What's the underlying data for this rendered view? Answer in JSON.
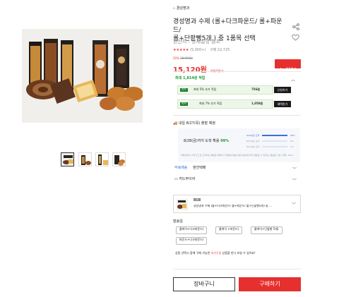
{
  "breadcrumb": {
    "store": "경성명과"
  },
  "product": {
    "title_line1": "경성명과 수제 (롤+다크파운드/ 롤+파운드/",
    "title_line2": "롤+단팥빵5개 ) 중 1품목 선택",
    "origin": "원산지 : 상세설명 참조",
    "stars": "★★★★★",
    "rating": "(5,000+)",
    "purchases": "구매 22,725",
    "discount": "20%",
    "original_price": "18,900원",
    "price": "15,120원",
    "price_note": "쿠폰적용가",
    "coupon_button": "쿠폰받기"
  },
  "rewards": {
    "max_label": "최대 1,814원 적립",
    "card1_text": "최대 5% 추가 적립",
    "card1_points": "756원",
    "card1_button": "신청하기",
    "card2_text": "최대 7% 추가 적립",
    "card2_points": "1,058원",
    "card2_button": "혜택받기"
  },
  "delivery": {
    "eta": "내일 8/27(목) 출발 예정",
    "arrival_prefix": "8/28(금)까지 도착 확률",
    "arrival_pct": "99%",
    "bars": [
      {
        "label": "8/28(금) 도착",
        "pct_label": "99%",
        "fill": 0.99
      },
      {
        "label": "8/29(토) 도착",
        "pct_label": "0%",
        "fill": 0.0
      },
      {
        "label": "8/31(월) 도착",
        "pct_label": "1%",
        "fill": 0.01
      }
    ],
    "note": "택배사에서 가져가고 한 도착하는 확률은 예측이기 때문에 배송사정과 날씨에 따라 변동될 수 있어요 (발송일 기준, 주말/공휴일 제외)",
    "more": "More",
    "shipping_label": "무료배송",
    "shipping_value": "판진택배"
  },
  "card_promo": {
    "label": "카드무이자"
  },
  "option": {
    "badge": "선택",
    "name": "경성명과 수제 (롤+다크파운드/ 롤+파운드/ 롤+단팥빵5개) 중 ..."
  },
  "options_section": {
    "title": "발송일",
    "chips": [
      "롤케익+다크파운드(",
      "롤케익 +파운드(",
      "롤케익+단팥빵 5개(",
      "파운드+다크파운드("
    ]
  },
  "notice": {
    "prefix": "상품 선택시 함께 구매 가능한",
    "link": "추가구성",
    "suffix": "상품을 만나 보실 수 있어요!"
  },
  "actions": {
    "cart": "장바구니",
    "buy": "구매하기"
  },
  "colors": {
    "accent": "#e5302f",
    "green": "#1a9a35"
  }
}
